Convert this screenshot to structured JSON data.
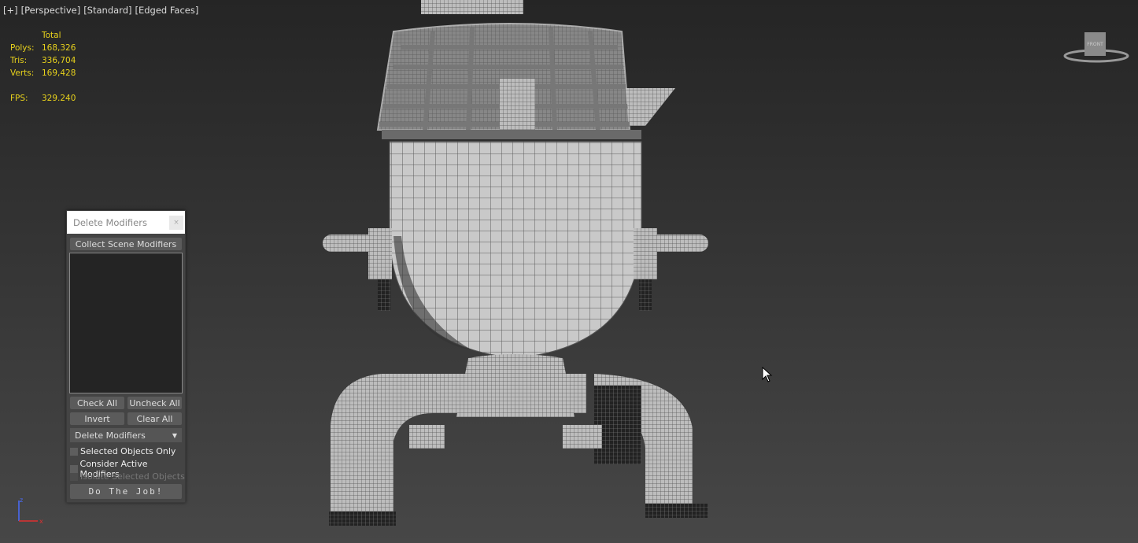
{
  "viewport": {
    "labels": [
      "[+]",
      "[Perspective]",
      "[Standard]",
      "[Edged Faces]"
    ]
  },
  "stats": {
    "header": "Total",
    "rows": [
      {
        "k": "Polys:",
        "v": "168,326"
      },
      {
        "k": "Tris:",
        "v": "336,704"
      },
      {
        "k": "Verts:",
        "v": "169,428"
      }
    ],
    "fps_label": "FPS:",
    "fps": "329.240"
  },
  "viewcube": {
    "face": "FRONT"
  },
  "axis": {
    "z": "z",
    "x": "x"
  },
  "dialog": {
    "title": "Delete Modifiers",
    "close": "×",
    "collect": "Collect Scene Modifiers",
    "check_all": "Check All",
    "uncheck_all": "Uncheck All",
    "invert": "Invert",
    "clear_all": "Clear All",
    "mode": "Delete Modifiers",
    "opt1": "Selected Objects Only",
    "opt2": "Consider Active Modifiers",
    "opt3": "Isolate Selected Objects",
    "do_job": "Do The Job!"
  }
}
